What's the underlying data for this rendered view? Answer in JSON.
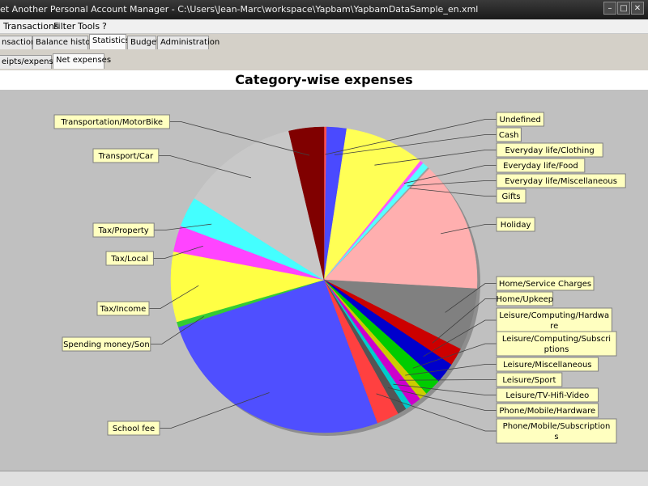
{
  "window": {
    "title": "et Another Personal Account Manager - C:\\Users\\Jean-Marc\\workspace\\Yapbam\\YapbamDataSample_en.xml",
    "controls": [
      "–",
      "□",
      "✕"
    ]
  },
  "menu": [
    "Transactions",
    "Filter",
    "Tools",
    "?"
  ],
  "tabs": [
    {
      "label": "nsactions",
      "active": false
    },
    {
      "label": "Balance history",
      "active": false
    },
    {
      "label": "Statistics",
      "active": true
    },
    {
      "label": "Budget",
      "active": false
    },
    {
      "label": "Administration",
      "active": false
    }
  ],
  "subtabs": [
    {
      "label": "eipts/expenses",
      "active": false
    },
    {
      "label": "Net expenses",
      "active": true
    }
  ],
  "chart_data": {
    "type": "pie",
    "title": "Category-wise expenses",
    "start_angle_deg": 90,
    "direction": "clockwise",
    "slices": [
      {
        "label": "Undefined",
        "value": 0.3,
        "color": "#ff5050",
        "side": "right"
      },
      {
        "label": "Cash",
        "value": 2.2,
        "color": "#4a4aff",
        "side": "right"
      },
      {
        "label": "Everyday life/Clothing",
        "value": 8.9,
        "color": "#ffff55",
        "side": "right"
      },
      {
        "label": "Everyday life/Food",
        "value": 0.4,
        "color": "#ff55ff",
        "side": "right"
      },
      {
        "label": "Everyday life/Miscellaneous",
        "value": 0.7,
        "color": "#55ffff",
        "side": "right"
      },
      {
        "label": "Gifts",
        "value": 0.2,
        "color": "#a0a0a0",
        "side": "right"
      },
      {
        "label": "Holiday",
        "value": 14.6,
        "color": "#ffafaf",
        "side": "right"
      },
      {
        "label": "Home/Service Charges",
        "value": 6.9,
        "color": "#808080",
        "side": "right"
      },
      {
        "label": "Home/Upkeep",
        "value": 2.0,
        "color": "#cc0000",
        "side": "right"
      },
      {
        "label": "Leisure/Computing/Hardware",
        "value": 2.3,
        "color": "#0000cc",
        "side": "right"
      },
      {
        "label": "Leisure/Computing/Subscriptions",
        "value": 1.9,
        "color": "#00cc00",
        "side": "right"
      },
      {
        "label": "Leisure/Miscellaneous",
        "value": 0.9,
        "color": "#cccc00",
        "side": "right"
      },
      {
        "label": "Leisure/Sport",
        "value": 1.2,
        "color": "#cc00cc",
        "side": "right"
      },
      {
        "label": "Leisure/TV-Hifi-Video",
        "value": 0.7,
        "color": "#00cccc",
        "side": "right"
      },
      {
        "label": "Phone/Mobile/Hardware",
        "value": 1.0,
        "color": "#555555",
        "side": "right"
      },
      {
        "label": "Phone/Mobile/Subscriptions",
        "value": 2.5,
        "color": "#ff4040",
        "side": "right"
      },
      {
        "label": "School fee",
        "value": 27.0,
        "color": "#4f4fff",
        "side": "left"
      },
      {
        "label": "Spending money/Son",
        "value": 0.6,
        "color": "#33cc33",
        "side": "left"
      },
      {
        "label": "Tax/Income",
        "value": 7.8,
        "color": "#ffff44",
        "side": "left"
      },
      {
        "label": "Tax/Local",
        "value": 2.9,
        "color": "#ff44ff",
        "side": "left"
      },
      {
        "label": "Tax/Property",
        "value": 3.4,
        "color": "#44ffff",
        "side": "left"
      },
      {
        "label": "Transport/Car",
        "value": 13.0,
        "color": "#c8c8c8",
        "side": "left"
      },
      {
        "label": "Transportation/MotorBike",
        "value": 3.9,
        "color": "#800000",
        "side": "left"
      }
    ]
  }
}
